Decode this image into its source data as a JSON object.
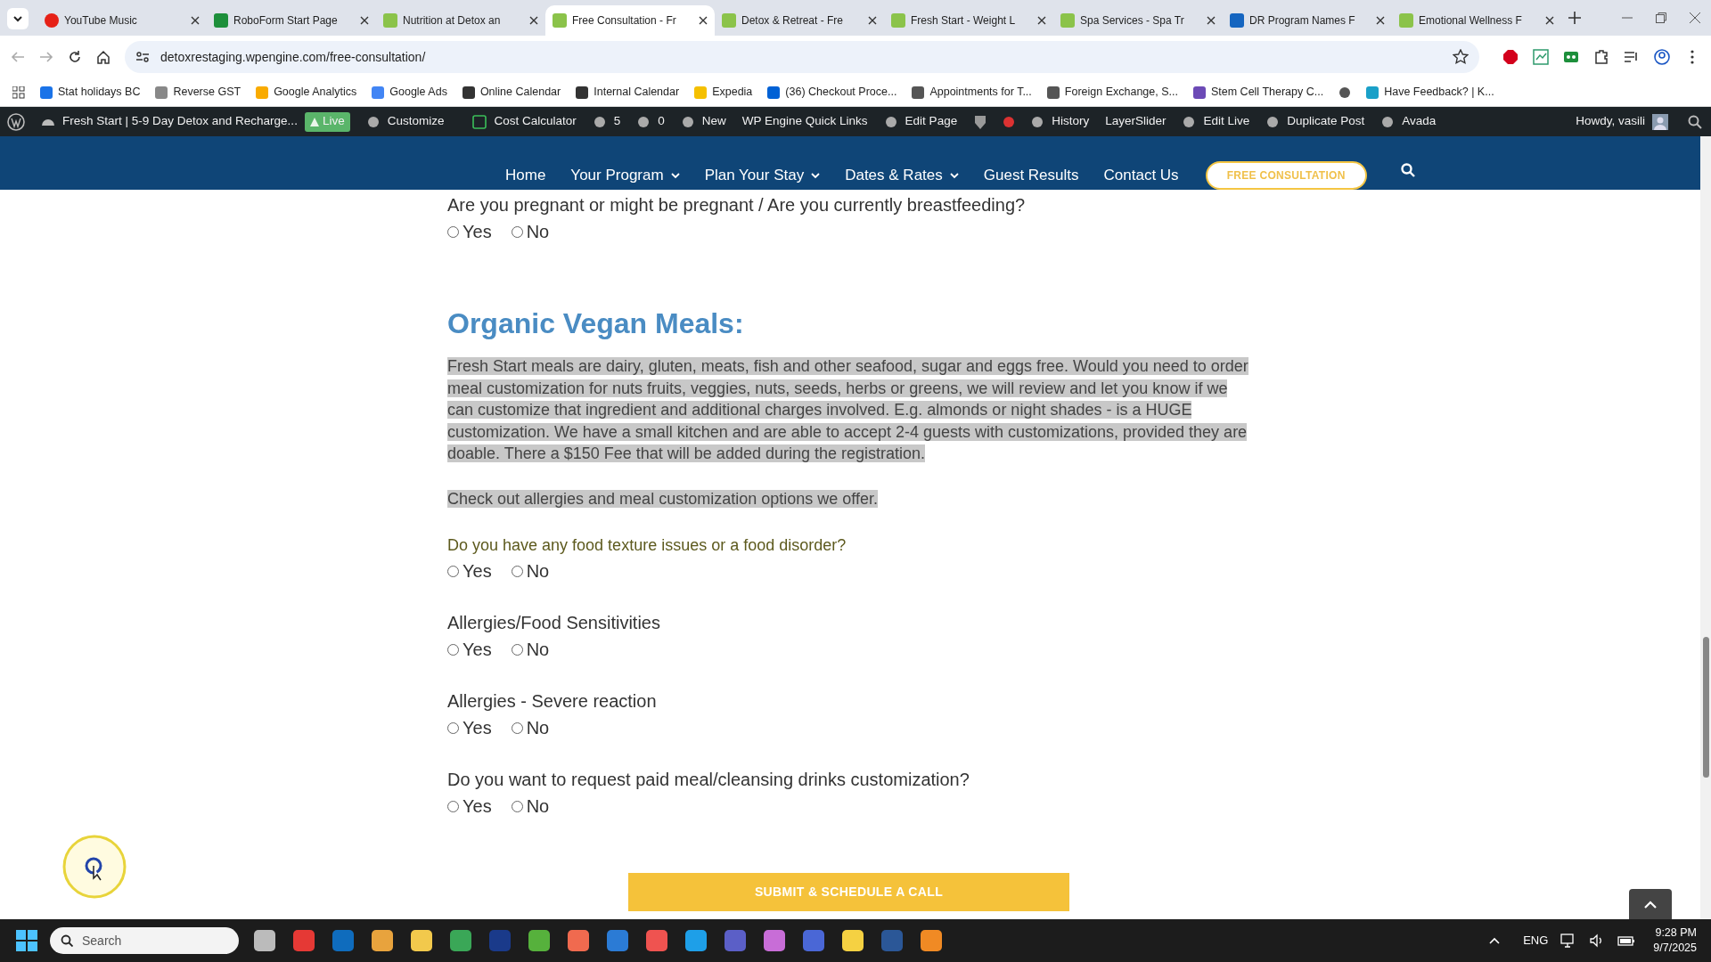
{
  "browser": {
    "tabs": [
      {
        "title": "YouTube Music",
        "selected": false
      },
      {
        "title": "RoboForm Start Page",
        "selected": false
      },
      {
        "title": "Nutrition at Detox an",
        "selected": false
      },
      {
        "title": "Free Consultation - Fr",
        "selected": true
      },
      {
        "title": "Detox & Retreat - Fre",
        "selected": false
      },
      {
        "title": "Fresh Start - Weight L",
        "selected": false
      },
      {
        "title": "Spa Services - Spa Tr",
        "selected": false
      },
      {
        "title": "DR Program Names F",
        "selected": false
      },
      {
        "title": "Emotional Wellness F",
        "selected": false
      }
    ],
    "address": "detoxrestaging.wpengine.com/free-consultation/",
    "bookmarks": [
      "Stat holidays BC",
      "Reverse GST",
      "Google Analytics",
      "Google Ads",
      "Online Calendar",
      "Internal Calendar",
      "Expedia",
      "(36) Checkout Proce...",
      "Appointments for T...",
      "Foreign Exchange, S...",
      "Stem Cell Therapy C...",
      "Have Feedback? | K..."
    ]
  },
  "admin_bar": {
    "site": "Fresh Start | 5-9 Day Detox and Recharge...",
    "live_badge": "Live",
    "items": [
      "Customize",
      "Cost Calculator",
      "5",
      "0",
      "New",
      "WP Engine Quick Links",
      "Edit Page"
    ],
    "items_2": [
      "History",
      "LayerSlider",
      "Edit Live",
      "Duplicate Post",
      "Avada"
    ],
    "greeting": "Howdy, vasili"
  },
  "nav": {
    "items": [
      {
        "label": "Home",
        "dropdown": false
      },
      {
        "label": "Your Program",
        "dropdown": true
      },
      {
        "label": "Plan Your Stay",
        "dropdown": true
      },
      {
        "label": "Dates & Rates",
        "dropdown": true
      },
      {
        "label": "Guest Results",
        "dropdown": false
      },
      {
        "label": "Contact Us",
        "dropdown": false
      }
    ],
    "cta": "FREE CONSULTATION"
  },
  "form": [
    {
      "kind": "question",
      "text": "Are you pregnant or might be pregnant / Are you currently breastfeeding?",
      "options": [
        {
          "label": "Yes",
          "selected": false
        },
        {
          "label": "No",
          "selected": false
        }
      ]
    },
    {
      "kind": "heading",
      "text": "Organic Vegan Meals:"
    },
    {
      "kind": "paragraph",
      "highlighted": true,
      "text": "Fresh Start meals are dairy, gluten, meats, fish and other seafood, sugar and eggs free. Would you need to order meal customization for nuts fruits, veggies, nuts, seeds, herbs or greens, we will review and let you know if we can customize that ingredient and additional charges involved. E.g. almonds or night shades - is a HUGE customization. We have a small kitchen and are able to accept 2-4 guests with customizations, provided they are doable. There a $150 Fee that will be added during the registration."
    },
    {
      "kind": "paragraph",
      "highlighted": true,
      "text": "Check out allergies and meal customization options we offer."
    },
    {
      "kind": "subquestion",
      "text": "Do you have any food texture issues or a food disorder?",
      "options": [
        {
          "label": "Yes",
          "selected": false
        },
        {
          "label": "No",
          "selected": false
        }
      ]
    },
    {
      "kind": "question",
      "text": "Allergies/Food Sensitivities",
      "options": [
        {
          "label": "Yes",
          "selected": false
        },
        {
          "label": "No",
          "selected": false
        }
      ]
    },
    {
      "kind": "question",
      "text": "Allergies - Severe reaction",
      "options": [
        {
          "label": "Yes",
          "selected": false
        },
        {
          "label": "No",
          "selected": false
        }
      ]
    },
    {
      "kind": "question",
      "text": "Do you want to request paid meal/cleansing drinks customization?",
      "options": [
        {
          "label": "Yes",
          "selected": false
        },
        {
          "label": "No",
          "selected": false
        }
      ]
    }
  ],
  "submit": "SUBMIT & SCHEDULE A CALL",
  "taskbar": {
    "search_placeholder": "Search",
    "language": "ENG",
    "time": "9:28 PM",
    "date": "9/7/2025"
  }
}
